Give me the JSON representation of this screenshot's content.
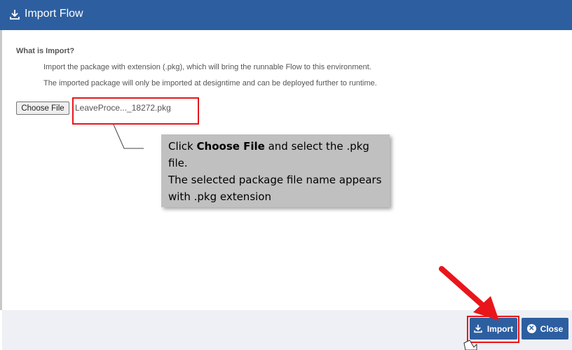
{
  "dialog": {
    "title": "Import Flow",
    "heading": "What is Import?",
    "description_line1": "Import the package with extension (.pkg), which will bring the runnable Flow to this environment.",
    "description_line2": "The imported package will only be imported at designtime and can be deployed further to runtime."
  },
  "file_input": {
    "button_label": "Choose File",
    "filename": "LeaveProce..._18272.pkg"
  },
  "callout": {
    "prefix": "Click ",
    "emphasis": "Choose File",
    "suffix": " and select the .pkg file.",
    "line2": "The selected package file name appears with .pkg extension"
  },
  "footer": {
    "import_label": "Import",
    "close_label": "Close"
  },
  "colors": {
    "header": "#2d5fa0",
    "highlight": "#e8161b",
    "callout_bg": "#c0c0c0"
  },
  "icons": {
    "title": "download-icon",
    "import": "download-icon",
    "close": "close-circle-icon"
  }
}
